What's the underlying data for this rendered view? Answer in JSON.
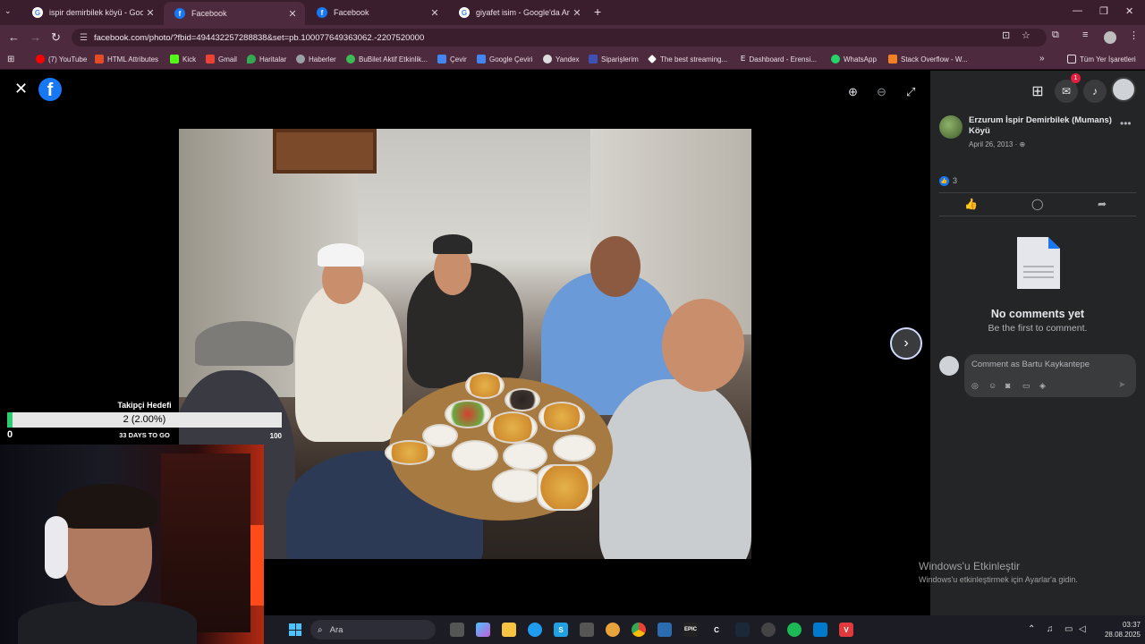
{
  "browser": {
    "tabs": [
      {
        "title": "ispir demirbilek köyü - Google'd",
        "favicon": "google-icon",
        "active": false
      },
      {
        "title": "Facebook",
        "favicon": "facebook-icon",
        "active": true
      },
      {
        "title": "Facebook",
        "favicon": "facebook-icon",
        "active": false
      },
      {
        "title": "giyafet isim - Google'da Ara",
        "favicon": "google-icon",
        "active": false
      }
    ],
    "url": "facebook.com/photo/?fbid=494432257288838&set=pb.100077649363062.-2207520000",
    "bookmarks": [
      {
        "label": "(7) YouTube",
        "color": "#ff0000"
      },
      {
        "label": "HTML Attributes",
        "color": "#e34c26"
      },
      {
        "label": "Kick",
        "color": "#53fc18"
      },
      {
        "label": "Gmail",
        "color": "#ea4335"
      },
      {
        "label": "Haritalar",
        "color": "#34a853"
      },
      {
        "label": "Haberler",
        "color": "#9aa0a6"
      },
      {
        "label": "BuBilet Aktif Etkinlik...",
        "color": "#3cba54"
      },
      {
        "label": "Çevir",
        "color": "#4285f4"
      },
      {
        "label": "Google Çeviri",
        "color": "#4285f4"
      },
      {
        "label": "Yandex",
        "color": "#dddddd"
      },
      {
        "label": "Siparişlerim",
        "color": "#3f51b5"
      },
      {
        "label": "The best streaming...",
        "color": "#ffffff"
      },
      {
        "label": "Dashboard - Erensi...",
        "color": "#ffffff"
      },
      {
        "label": "WhatsApp",
        "color": "#25d366"
      },
      {
        "label": "Stack Overflow - W...",
        "color": "#f48024"
      }
    ],
    "all_bookmarks": "Tüm Yer İşaretleri"
  },
  "viewer": {
    "next_icon": "chevron-right-icon"
  },
  "panel": {
    "notification_count": "1",
    "poster_name": "Erzurum İspir Demirbilek (Mumans) Köyü",
    "post_date": "April 26, 2013 · ",
    "privacy_icon": "globe-icon",
    "like_count": "3",
    "no_comments_title": "No comments yet",
    "no_comments_sub": "Be the first to comment.",
    "comment_placeholder": "Comment as Bartu Kaykantepe"
  },
  "stream_goal": {
    "title": "Takipçi Hedefi",
    "value_text": "2 (2.00%)",
    "progress": 0.02,
    "min": "0",
    "days_left": "33 DAYS TO GO",
    "max": "100"
  },
  "windows_activation": {
    "title": "Windows'u Etkinleştir",
    "subtitle": "Windows'u etkinleştirmek için Ayarlar'a gidin."
  },
  "taskbar": {
    "search_label": "Ara",
    "time": "03:37",
    "date": "28.08.2025"
  }
}
